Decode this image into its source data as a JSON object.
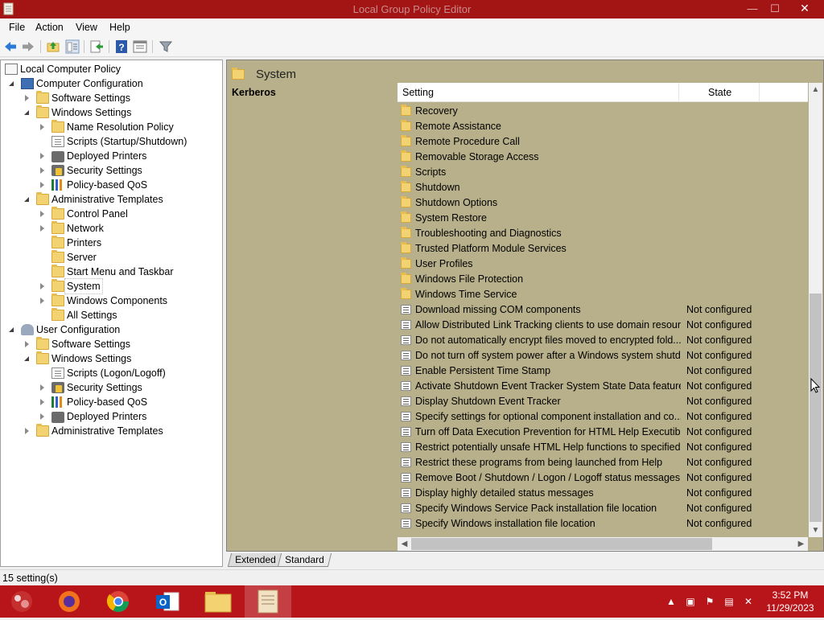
{
  "window": {
    "title": "Local Group Policy Editor",
    "controls": {
      "minimize": "—",
      "maximize": "☐",
      "close": "✕"
    }
  },
  "menu": [
    "File",
    "Action",
    "View",
    "Help"
  ],
  "toolbar": {
    "icons": [
      "back-arrow-icon",
      "forward-arrow-icon",
      "up-folder-icon",
      "show-hide-tree-icon",
      "export-list-icon",
      "help-icon",
      "properties-icon",
      "filter-icon"
    ]
  },
  "tree": {
    "root": "Local Computer Policy",
    "nodes": [
      {
        "label": "Computer Configuration"
      },
      {
        "label": "Software Settings"
      },
      {
        "label": "Windows Settings"
      },
      {
        "label": "Name Resolution Policy"
      },
      {
        "label": "Scripts (Startup/Shutdown)"
      },
      {
        "label": "Deployed Printers"
      },
      {
        "label": "Security Settings"
      },
      {
        "label": "Policy-based QoS"
      },
      {
        "label": "Administrative Templates"
      },
      {
        "label": "Control Panel"
      },
      {
        "label": "Network"
      },
      {
        "label": "Printers"
      },
      {
        "label": "Server"
      },
      {
        "label": "Start Menu and Taskbar"
      },
      {
        "label": "System"
      },
      {
        "label": "Windows Components"
      },
      {
        "label": "All Settings"
      },
      {
        "label": "User Configuration"
      },
      {
        "label": "Software Settings"
      },
      {
        "label": "Windows Settings"
      },
      {
        "label": "Scripts (Logon/Logoff)"
      },
      {
        "label": "Security Settings"
      },
      {
        "label": "Policy-based QoS"
      },
      {
        "label": "Deployed Printers"
      },
      {
        "label": "Administrative Templates"
      }
    ]
  },
  "details": {
    "header": "System",
    "description_title": "Kerberos",
    "columns": {
      "setting": "Setting",
      "state": "State"
    },
    "rows": [
      {
        "name": "Recovery",
        "state": ""
      },
      {
        "name": "Remote Assistance",
        "state": ""
      },
      {
        "name": "Remote Procedure Call",
        "state": ""
      },
      {
        "name": "Removable Storage Access",
        "state": ""
      },
      {
        "name": "Scripts",
        "state": ""
      },
      {
        "name": "Shutdown",
        "state": ""
      },
      {
        "name": "Shutdown Options",
        "state": ""
      },
      {
        "name": "System Restore",
        "state": ""
      },
      {
        "name": "Troubleshooting and Diagnostics",
        "state": ""
      },
      {
        "name": "Trusted Platform Module Services",
        "state": ""
      },
      {
        "name": "User Profiles",
        "state": ""
      },
      {
        "name": "Windows File Protection",
        "state": ""
      },
      {
        "name": "Windows Time Service",
        "state": ""
      },
      {
        "name": "Download missing COM components",
        "state": "Not configured"
      },
      {
        "name": "Allow Distributed Link Tracking clients to use domain resour...",
        "state": "Not configured"
      },
      {
        "name": "Do not automatically encrypt files moved to encrypted fold...",
        "state": "Not configured"
      },
      {
        "name": "Do not turn off system power after a Windows system shutd...",
        "state": "Not configured"
      },
      {
        "name": "Enable Persistent Time Stamp",
        "state": "Not configured"
      },
      {
        "name": "Activate Shutdown Event Tracker System State Data feature",
        "state": "Not configured"
      },
      {
        "name": "Display Shutdown Event Tracker",
        "state": "Not configured"
      },
      {
        "name": "Specify settings for optional component installation and co...",
        "state": "Not configured"
      },
      {
        "name": "Turn off Data Execution Prevention for HTML Help Executible",
        "state": "Not configured"
      },
      {
        "name": "Restrict potentially unsafe HTML Help functions to specified...",
        "state": "Not configured"
      },
      {
        "name": "Restrict these programs from being launched from Help",
        "state": "Not configured"
      },
      {
        "name": "Remove Boot / Shutdown / Logon / Logoff status messages",
        "state": "Not configured"
      },
      {
        "name": "Display highly detailed status messages",
        "state": "Not configured"
      },
      {
        "name": "Specify Windows Service Pack installation file location",
        "state": "Not configured"
      },
      {
        "name": "Specify Windows installation file location",
        "state": "Not configured"
      }
    ]
  },
  "tabs": [
    "Extended",
    "Standard"
  ],
  "status": "15 setting(s)",
  "taskbar": {
    "apps": [
      "start-button-icon",
      "firefox-icon",
      "chrome-icon",
      "outlook-icon",
      "file-explorer-icon",
      "group-policy-editor-icon"
    ],
    "time": "3:52 PM",
    "date": "11/29/2023"
  },
  "colors": {
    "titlebar": "#a31515",
    "content_background": "#b8b08a",
    "taskbar": "#b8151b"
  }
}
